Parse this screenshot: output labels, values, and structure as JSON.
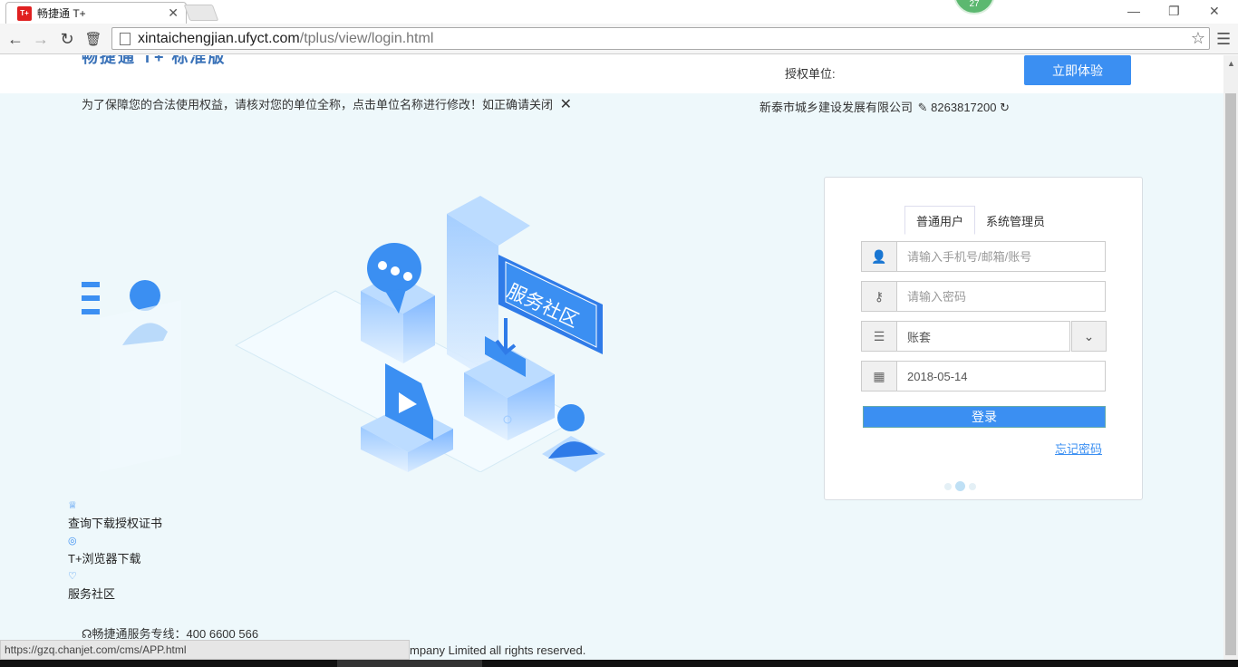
{
  "browser": {
    "tab_title": "畅捷通 T+",
    "tab_favicon": "T+",
    "badge": "27",
    "url_domain": "xintaichengjian.ufyct.com",
    "url_path": "/tplus/view/login.html",
    "status_url": "https://gzq.chanjet.com/cms/APP.html"
  },
  "header": {
    "logo": "畅捷通 T+ 标准版",
    "auth_label": "授权单位:",
    "try_button": "立即体验"
  },
  "notice": {
    "text": "为了保障您的合法使用权益，请核对您的单位全称，点击单位名称进行修改！如正确请关闭",
    "close": "✕"
  },
  "company": {
    "name": "新泰市城乡建设发展有限公司",
    "code": "8263817200"
  },
  "illustration": {
    "label": "服务社区"
  },
  "login": {
    "tabs": [
      {
        "label": "普通用户",
        "active": true
      },
      {
        "label": "系统管理员",
        "active": false
      }
    ],
    "username_placeholder": "请输入手机号/邮箱/账号",
    "password_placeholder": "请输入密码",
    "account_set_value": "账套",
    "date_value": "2018-05-14",
    "login_button": "登录",
    "forgot": "忘记密码"
  },
  "links": [
    {
      "label": "查询下载授权证书"
    },
    {
      "label": "T+浏览器下载"
    },
    {
      "label": "服务社区"
    }
  ],
  "footer": {
    "hotline": "畅捷通服务专线：400 6600 566",
    "copyright": "mpany Limited all rights reserved."
  },
  "colors": {
    "accent": "#3b8ff2",
    "page_bg": "#eef8fb"
  }
}
